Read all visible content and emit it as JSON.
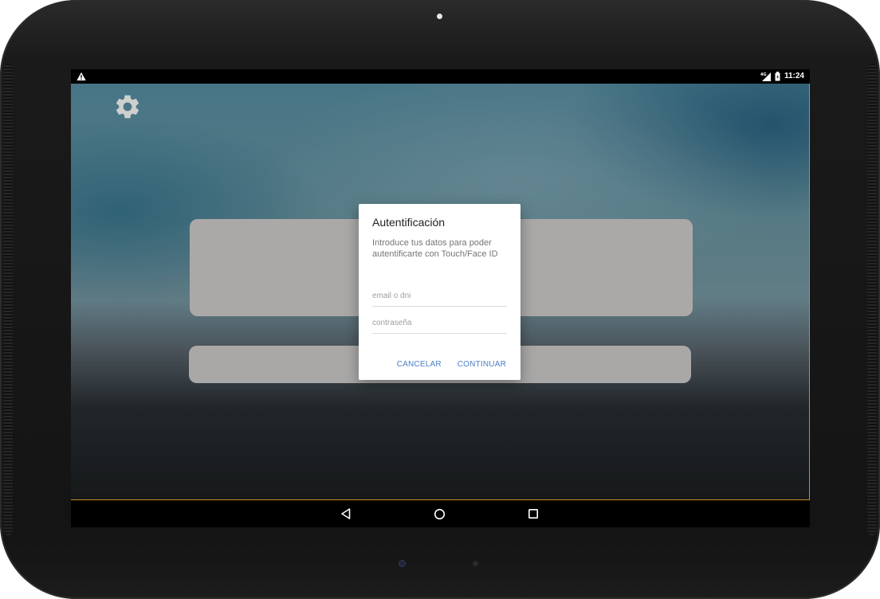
{
  "status_bar": {
    "time": "11:24",
    "network": "4G",
    "warning_icon": "warning-icon",
    "signal_icon": "signal-icon",
    "battery_icon": "battery-icon"
  },
  "app": {
    "settings_icon": "gear-icon"
  },
  "dialog": {
    "title": "Autentificación",
    "message": "Introduce tus datos para poder autentificarte con Touch/Face ID",
    "email_placeholder": "email o dni",
    "email_value": "",
    "password_placeholder": "contraseña",
    "password_value": "",
    "cancel_label": "CANCELAR",
    "continue_label": "CONTINUAR"
  },
  "nav_bar": {
    "back_icon": "back-triangle-icon",
    "home_icon": "home-circle-icon",
    "recents_icon": "recents-square-icon"
  },
  "colors": {
    "accent": "#4a7fc4",
    "dialog_background": "#ffffff",
    "window_border": "#c8901e"
  }
}
